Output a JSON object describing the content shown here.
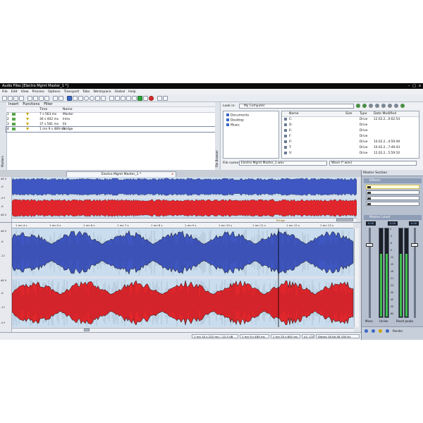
{
  "window": {
    "title": "Audio Files [Electro Mgmt Master_1 *]",
    "minimize": "–",
    "maximize": "□",
    "close": "x"
  },
  "menu": [
    "File",
    "Edit",
    "View",
    "Process",
    "Options",
    "Transport",
    "Tabs",
    "Workspace",
    "Global",
    "Help"
  ],
  "markers": {
    "side_tab": "Markers",
    "toolbar": {
      "insert": "Insert",
      "functions": "Functions",
      "filter": "Filter"
    },
    "columns": {
      "time": "Time",
      "name": "Name"
    },
    "rows": [
      {
        "index": "1",
        "time": "7 s 563 ms",
        "name": "Master"
      },
      {
        "index": "2",
        "time": "30 s 402 ms",
        "name": "Intro"
      },
      {
        "index": "3",
        "time": "37 s 581 ms",
        "name": "Ek"
      },
      {
        "index": "4",
        "time": "1 mn 9 s 489 ms",
        "name": "Bridge"
      }
    ]
  },
  "browser": {
    "side_tab": "File Browser",
    "look_in_label": "Look in:",
    "look_in_value": "My Computer",
    "places": [
      "Documents",
      "Desktop",
      "Music"
    ],
    "columns": {
      "name": "Name",
      "size": "Size",
      "type": "Type",
      "date": "Date Modified"
    },
    "files": [
      {
        "name": "C:",
        "type": "Drive",
        "date": "12.02.2...0:02:54"
      },
      {
        "name": "D:",
        "type": "Drive",
        "date": ""
      },
      {
        "name": "E:",
        "type": "Drive",
        "date": ""
      },
      {
        "name": "F:",
        "type": "Drive",
        "date": ""
      },
      {
        "name": "P:",
        "type": "Drive",
        "date": "10.02.2...4:59:49"
      },
      {
        "name": "T:",
        "type": "Drive",
        "date": "10.02.2...7:49:43"
      },
      {
        "name": "V:",
        "type": "Drive",
        "date": "12.02.2...5:59:10"
      }
    ],
    "file_name_label": "File name:",
    "file_name_value": "Electro Mgmt Master_1.wav",
    "file_type_value": "Wave (*.wav)"
  },
  "document": {
    "tab_title": "Electro Mgmt Master_1 *",
    "tab_close": "x",
    "overview_gutter": [
      "dB 0",
      "-6",
      "-inf",
      "-6",
      "dB 0"
    ],
    "ruler_labels": [
      "1 mn 4 s",
      "1 mn 5 s",
      "1 mn 6 s",
      "1 mn 7 s",
      "1 mn 8 s",
      "1 mn 9 s",
      "1 mn 10 s",
      "1 mn 11 s",
      "1 mn 12 s",
      "1 mn 13 s"
    ],
    "marker_label": "Bridge",
    "main_gutter": [
      "dB 0",
      "-6",
      "-12",
      "dB 0",
      "-6",
      "-12",
      "-inf"
    ],
    "status": [
      "1 mn 10 s 232 ms / -22.5 dB",
      "1 mn 9 s 489 ms",
      "1 mn 25 s 692 ms",
      "x1: 170",
      "Stereo 16 bit 48 100 Hz"
    ]
  },
  "master": {
    "title": "Master Section",
    "effects_label": "Effects",
    "master_level_label": "Master Level",
    "db_left": "0.00",
    "db_mid": "0.00",
    "db_right": "0.00",
    "scale": [
      "0",
      "-3",
      "-6",
      "-9",
      "-12",
      "-15",
      "-18",
      "-21",
      "-24",
      "-30",
      "-40",
      "-50",
      "-60"
    ],
    "mono": "Mono",
    "unlink": "Unlink",
    "reset_peaks": "Reset peaks",
    "render": "Render",
    "level_fraction": 0.72
  },
  "colors": {
    "wave_left": "#3f57c2",
    "wave_right": "#e0262c",
    "wave_edge": "#111111"
  }
}
